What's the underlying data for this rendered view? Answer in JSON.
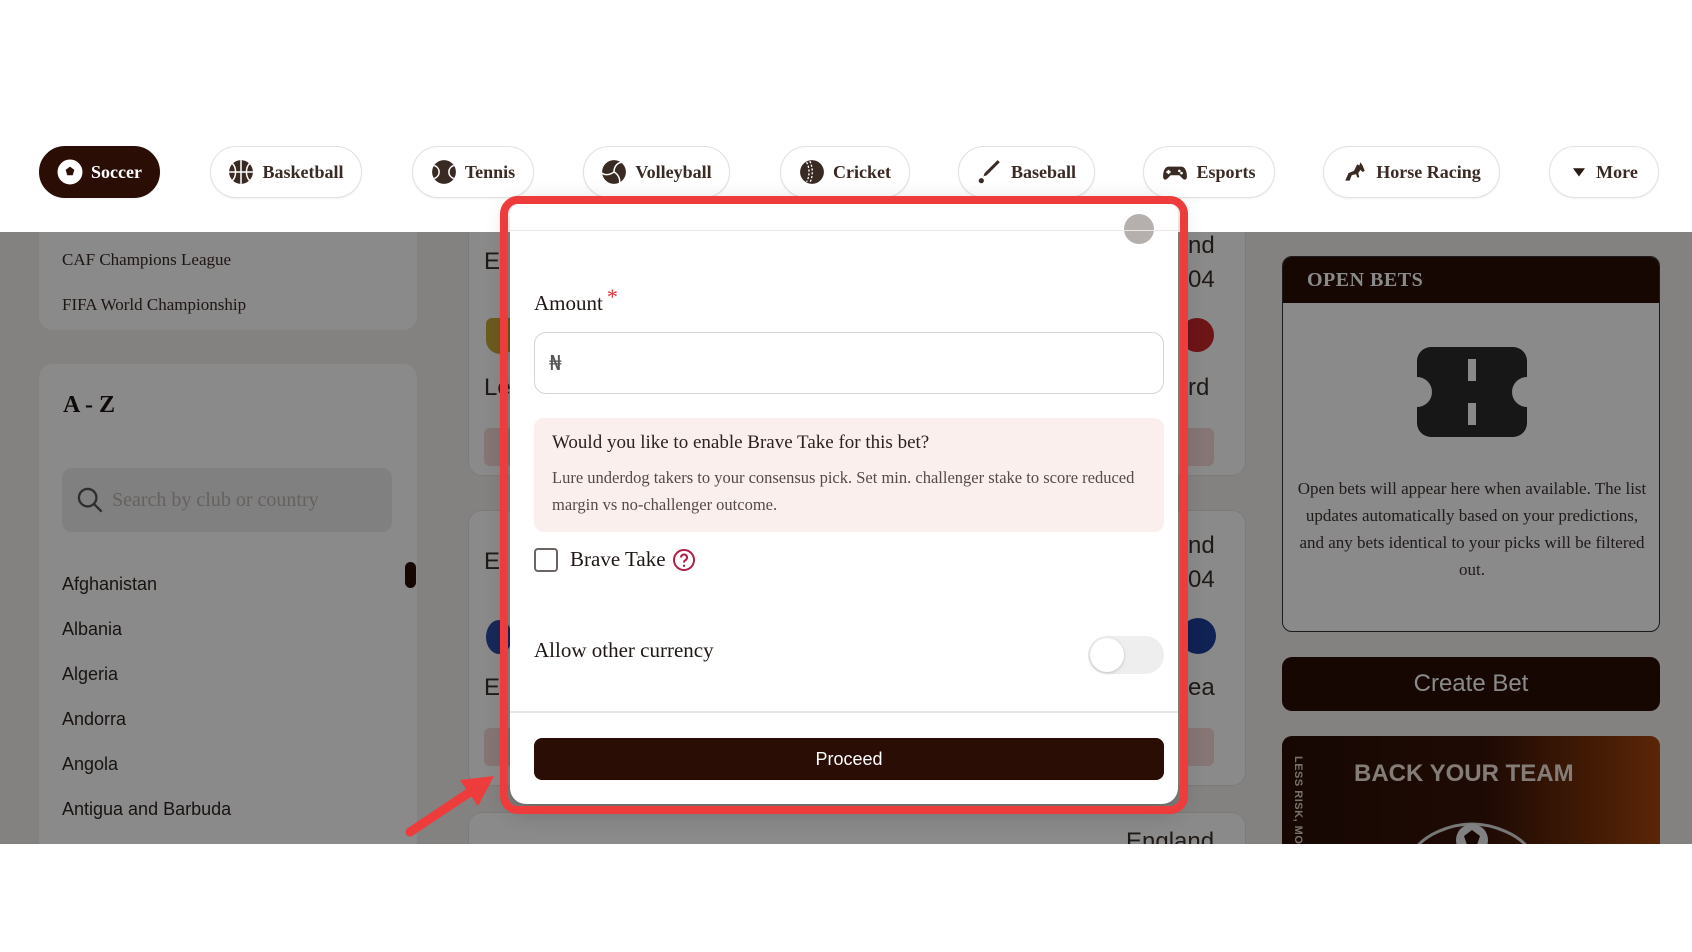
{
  "sports_nav": [
    {
      "label": "Soccer",
      "icon": "soccer-ball-icon",
      "active": true
    },
    {
      "label": "Basketball",
      "icon": "basketball-icon",
      "active": false
    },
    {
      "label": "Tennis",
      "icon": "tennis-ball-icon",
      "active": false
    },
    {
      "label": "Volleyball",
      "icon": "volleyball-icon",
      "active": false
    },
    {
      "label": "Cricket",
      "icon": "cricket-ball-icon",
      "active": false
    },
    {
      "label": "Baseball",
      "icon": "baseball-bat-icon",
      "active": false
    },
    {
      "label": "Esports",
      "icon": "gamepad-icon",
      "active": false
    },
    {
      "label": "Horse Racing",
      "icon": "horse-icon",
      "active": false
    },
    {
      "label": "More",
      "icon": "caret-down-icon",
      "active": false
    }
  ],
  "sidebar": {
    "leagues": [
      "CAF Champions League",
      "FIFA World Championship"
    ],
    "az_title": "A - Z",
    "search_placeholder": "Search by club or country",
    "countries": [
      "Afghanistan",
      "Albania",
      "Algeria",
      "Andorra",
      "Angola",
      "Antigua and Barbuda"
    ]
  },
  "match_fragments": {
    "card1": {
      "left_top": "E",
      "right_top": "nd",
      "right_time": "04",
      "left_team": "Le",
      "right_team": "rd"
    },
    "card2": {
      "left_top": "E",
      "right_top": "nd",
      "right_time": "04",
      "left_team": "E",
      "right_team": "ea"
    },
    "card3": {
      "right_top": "England"
    }
  },
  "open_bets": {
    "title": "OPEN BETS",
    "empty_text": "Open bets will appear here when available. The list updates automatically based on your predictions, and any bets identical to your picks will be filtered out."
  },
  "create_bet_label": "Create Bet",
  "promo": {
    "title": "BACK YOUR TEAM",
    "side_text": "LESS RISK, MO"
  },
  "modal": {
    "amount_label": "Amount",
    "required_mark": "*",
    "currency_symbol": "₦",
    "amount_value": "",
    "brave_question": "Would you like to enable Brave Take for this bet?",
    "brave_description": "Lure underdog takers to your consensus pick. Set min. challenger stake to score reduced margin vs no-challenger outcome.",
    "brave_take_label": "Brave Take",
    "brave_take_checked": false,
    "allow_currency_label": "Allow other currency",
    "allow_currency_on": false,
    "proceed_label": "Proceed"
  },
  "colors": {
    "brand_dark": "#2a0e06",
    "highlight_red": "#ee3b3b",
    "required_red": "#e2343b",
    "brave_box_bg": "#faefed"
  }
}
